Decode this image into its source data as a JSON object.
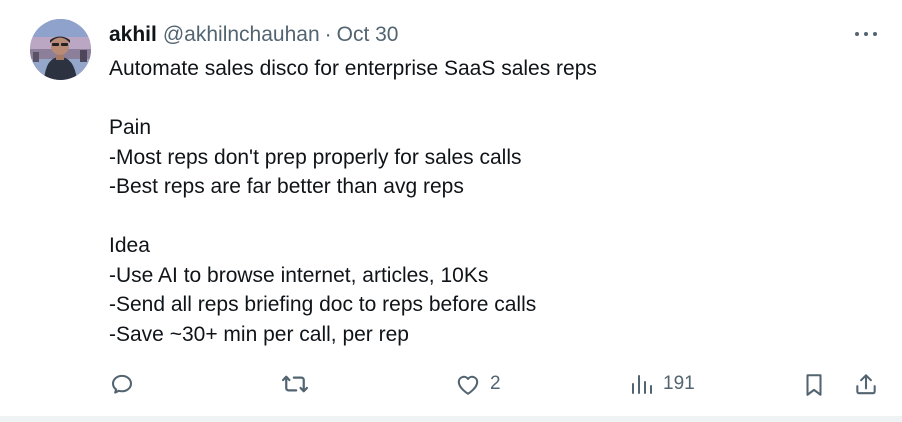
{
  "tweet": {
    "author": {
      "display_name": "akhil",
      "handle": "@akhilnchauhan",
      "separator": "·",
      "date": "Oct 30"
    },
    "body_lines": [
      "Automate sales disco for enterprise SaaS sales reps",
      "",
      "Pain",
      "-Most reps don't prep properly for sales calls",
      "-Best reps are far better than avg reps",
      "",
      "Idea",
      "-Use AI to browse internet, articles, 10Ks",
      "-Send all reps briefing doc to reps before calls",
      "-Save ~30+ min per call, per rep"
    ],
    "actions": {
      "reply": {
        "icon": "reply-icon"
      },
      "retweet": {
        "icon": "retweet-icon"
      },
      "like": {
        "icon": "heart-icon",
        "count": "2"
      },
      "views": {
        "icon": "analytics-icon",
        "count": "191"
      },
      "bookmark": {
        "icon": "bookmark-icon"
      },
      "share": {
        "icon": "share-icon"
      }
    },
    "more_icon": "more-horizontal-icon"
  },
  "colors": {
    "text_primary": "#0f1419",
    "text_secondary": "#536471",
    "divider": "#eff3f4"
  }
}
